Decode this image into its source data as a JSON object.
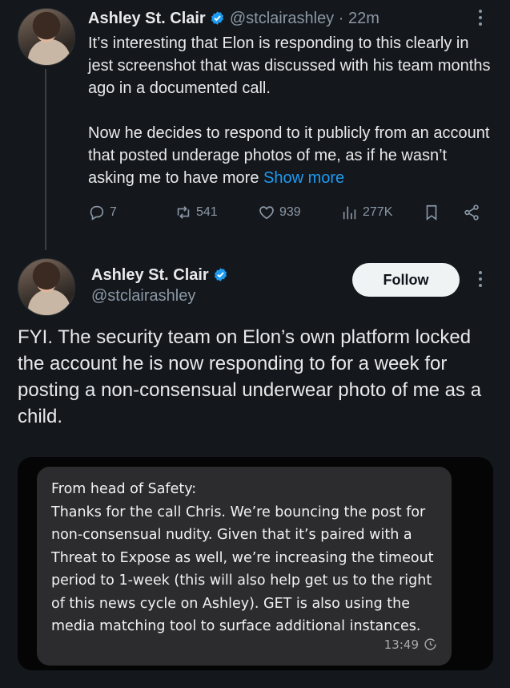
{
  "reply_tweet": {
    "author_name": "Ashley St. Clair",
    "handle": "@stclairashley",
    "separator": "·",
    "time": "22m",
    "body": "It’s interesting that Elon is responding to this clearly in jest screenshot that was discussed with his team months ago in a documented call.\n\nNow he decides to respond to it publicly from an account that posted underage photos of me, as if he wasn’t asking me to have more ",
    "show_more": "Show more",
    "replies": "7",
    "reposts": "541",
    "likes": "939",
    "views": "277K"
  },
  "main_tweet": {
    "author_name": "Ashley St. Clair",
    "handle": "@stclairashley",
    "follow_label": "Follow",
    "body": "FYI. The security team on Elon’s own platform locked the account he is now responding to for a week for posting a non-consensual underwear photo of me as a child."
  },
  "embedded_message": {
    "text": "From head of Safety:\nThanks for the call Chris. We’re bouncing the post for non-consensual nudity. Given that it’s paired with a Threat to Expose as well, we’re increasing the timeout period to 1-week (this will also help get us to the right of this news cycle on Ashley). GET is also using the media matching tool to surface additional instances.",
    "timestamp": "13:49"
  },
  "colors": {
    "background": "#14171c",
    "text": "#e7e9ea",
    "muted": "#8b98a5",
    "link": "#1d9bf0",
    "verified": "#1d9bf0",
    "bubble": "#2c2c2e"
  }
}
